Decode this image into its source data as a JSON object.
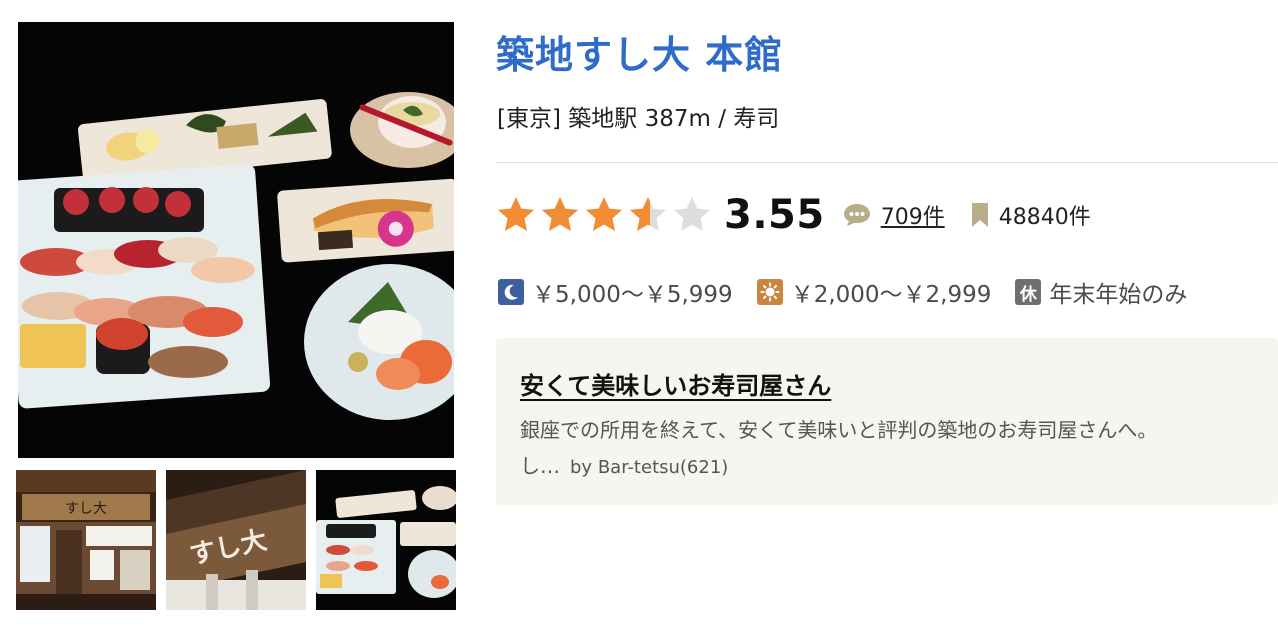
{
  "restaurant": {
    "name": "築地すし大 本館",
    "area": "[東京]",
    "station": "築地駅",
    "distance": "387m",
    "separator": "/",
    "genre": "寿司"
  },
  "rating": {
    "score": "3.55",
    "stars_value": 3.55,
    "star_color": "#f28c33",
    "star_empty_color": "#dddddd",
    "reviews_count": "709件",
    "bookmarks_count": "48840件"
  },
  "pricing": {
    "dinner": "￥5,000～￥5,999",
    "lunch": "￥2,000～￥2,999",
    "holiday_badge": "休",
    "holiday": "年末年始のみ"
  },
  "review": {
    "title": "安くて美味しいお寿司屋さん",
    "body_line1": "銀座での所用を終えて、安くて美味いと評判の築地のお寿司屋さんへ。",
    "body_line2": "し…",
    "by_prefix": "by",
    "author": "Bar-tetsu(621)"
  },
  "icons": {
    "dinner": "moon-icon",
    "lunch": "sun-icon",
    "reviews": "speech-bubble-icon",
    "bookmarks": "bookmark-icon"
  },
  "colors": {
    "title": "#2f6bc8",
    "dinner_badge": "#3d5f9e",
    "lunch_badge": "#c9873d",
    "holiday_badge": "#6f6f6f",
    "review_bg": "#f7f5f0"
  }
}
